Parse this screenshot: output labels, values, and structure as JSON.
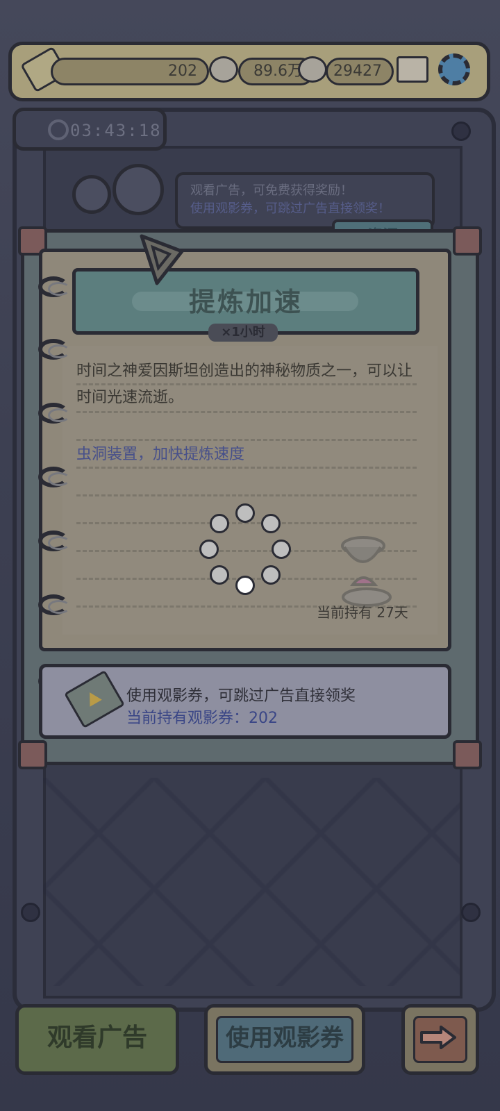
{
  "top_bar": {
    "tickets": "202",
    "currency_1": "89.6万",
    "currency_2": "29427"
  },
  "timer": "03:43:18",
  "ad_prompt": {
    "line1": "观看广告，可免费获得奖励！",
    "line2": "使用观影券，可跳过广告直接领奖！"
  },
  "resource_tab": "资源",
  "item": {
    "title": "提炼加速",
    "quantity": "×1小时",
    "description": "时间之神爱因斯坦创造出的神秘物质之一，可以让时间光速流逝。",
    "effect": "虫洞装置，加快提炼速度",
    "holding": "当前持有 27天"
  },
  "ticket_card": {
    "line1": "使用观影券，可跳过广告直接领奖",
    "line2": "当前持有观影券：202"
  },
  "buttons": {
    "watch_ad": "观看广告",
    "use_ticket": "使用观影券"
  },
  "loading": {
    "active_dot_index": 4,
    "dot_count": 8
  },
  "colors": {
    "ticket_text": "#3a4686",
    "effect_text": "#47508a",
    "watch_ad_button": "#60784a",
    "use_ticket_button": "#4f6a78"
  }
}
